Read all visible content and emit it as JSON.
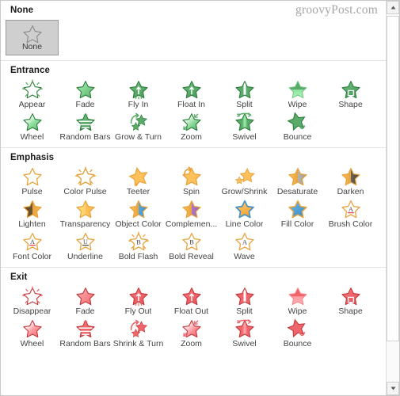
{
  "watermark": "groovyPost.com",
  "sections": [
    {
      "id": "none",
      "title": "None",
      "color": "#9a9a9a",
      "items": [
        {
          "label": "None",
          "icon": "star-outline-none",
          "selected": true
        }
      ]
    },
    {
      "id": "entrance",
      "title": "Entrance",
      "color": "#5aab69",
      "items": [
        {
          "label": "Appear",
          "icon": "star-burst-rays"
        },
        {
          "label": "Fade",
          "icon": "star-fade"
        },
        {
          "label": "Fly In",
          "icon": "star-arrow-up-trail"
        },
        {
          "label": "Float In",
          "icon": "star-arrow-up"
        },
        {
          "label": "Split",
          "icon": "star-split-vertical"
        },
        {
          "label": "Wipe",
          "icon": "star-wipe"
        },
        {
          "label": "Shape",
          "icon": "star-shape"
        },
        {
          "label": "Wheel",
          "icon": "star-wheel"
        },
        {
          "label": "Random Bars",
          "icon": "star-random-bars"
        },
        {
          "label": "Grow & Turn",
          "icon": "star-grow-turn"
        },
        {
          "label": "Zoom",
          "icon": "star-zoom-in"
        },
        {
          "label": "Swivel",
          "icon": "star-swivel"
        },
        {
          "label": "Bounce",
          "icon": "star-bounce"
        }
      ]
    },
    {
      "id": "emphasis",
      "title": "Emphasis",
      "color": "#e8a33d",
      "items": [
        {
          "label": "Pulse",
          "icon": "star-pulse"
        },
        {
          "label": "Color Pulse",
          "icon": "star-color-pulse"
        },
        {
          "label": "Teeter",
          "icon": "star-teeter"
        },
        {
          "label": "Spin",
          "icon": "star-spin"
        },
        {
          "label": "Grow/Shrink",
          "icon": "star-grow-shrink"
        },
        {
          "label": "Desaturate",
          "icon": "star-half-gray"
        },
        {
          "label": "Darken",
          "icon": "star-half-dark"
        },
        {
          "label": "Lighten",
          "icon": "star-half-brown"
        },
        {
          "label": "Transparency",
          "icon": "star-half-pale"
        },
        {
          "label": "Object Color",
          "icon": "star-half-blue"
        },
        {
          "label": "Complemen...",
          "icon": "star-half-purple"
        },
        {
          "label": "Line Color",
          "icon": "star-line-color"
        },
        {
          "label": "Fill Color",
          "icon": "star-fill-blue"
        },
        {
          "label": "Brush Color",
          "icon": "star-letter-a-underline"
        },
        {
          "label": "Font Color",
          "icon": "star-letter-a-underline"
        },
        {
          "label": "Underline",
          "icon": "star-letter-u-underline"
        },
        {
          "label": "Bold Flash",
          "icon": "star-letter-b-burst"
        },
        {
          "label": "Bold Reveal",
          "icon": "star-letter-b"
        },
        {
          "label": "Wave",
          "icon": "star-letter-a"
        }
      ]
    },
    {
      "id": "exit",
      "title": "Exit",
      "color": "#f0656a",
      "items": [
        {
          "label": "Disappear",
          "icon": "star-burst-rays"
        },
        {
          "label": "Fade",
          "icon": "star-fade"
        },
        {
          "label": "Fly Out",
          "icon": "star-arrow-up-trail"
        },
        {
          "label": "Float Out",
          "icon": "star-arrow-up"
        },
        {
          "label": "Split",
          "icon": "star-split-vertical"
        },
        {
          "label": "Wipe",
          "icon": "star-wipe"
        },
        {
          "label": "Shape",
          "icon": "star-shape"
        },
        {
          "label": "Wheel",
          "icon": "star-wheel"
        },
        {
          "label": "Random Bars",
          "icon": "star-random-bars"
        },
        {
          "label": "Shrink & Turn",
          "icon": "star-grow-turn"
        },
        {
          "label": "Zoom",
          "icon": "star-zoom-in"
        },
        {
          "label": "Swivel",
          "icon": "star-swivel"
        },
        {
          "label": "Bounce",
          "icon": "star-bounce"
        }
      ]
    }
  ],
  "scrollbar": {
    "up_arrow": "scroll-up-arrow",
    "down_arrow": "scroll-down-arrow",
    "thumb": "scroll-thumb"
  }
}
